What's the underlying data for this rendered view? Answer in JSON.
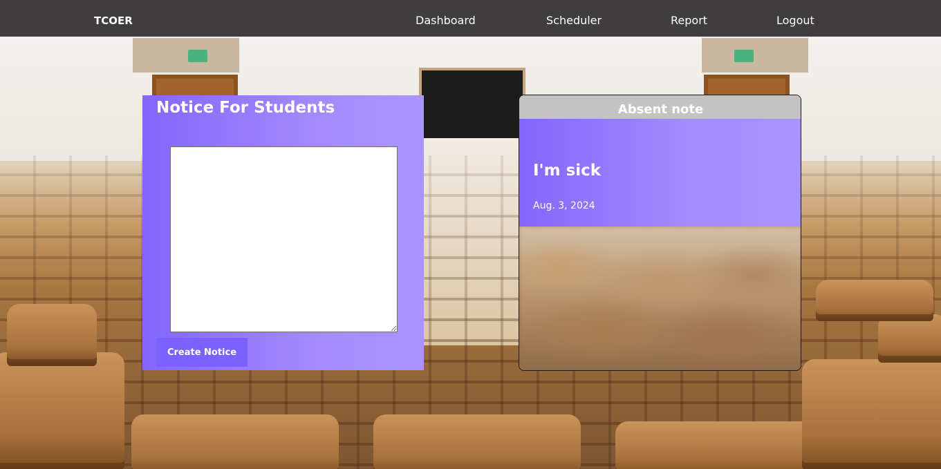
{
  "navbar": {
    "brand": "TCOER",
    "links": [
      {
        "label": "Dashboard"
      },
      {
        "label": "Scheduler"
      },
      {
        "label": "Report"
      },
      {
        "label": "Logout"
      }
    ],
    "background_color": "#3f3d3d"
  },
  "notice": {
    "title": "Notice For Students",
    "textarea_value": "",
    "button_label": "Create Notice",
    "accent_color": "#7b61ff"
  },
  "absent": {
    "title": "Absent note",
    "notes": [
      {
        "title": "I'm sick",
        "date": "Aug. 3, 2024"
      }
    ]
  }
}
